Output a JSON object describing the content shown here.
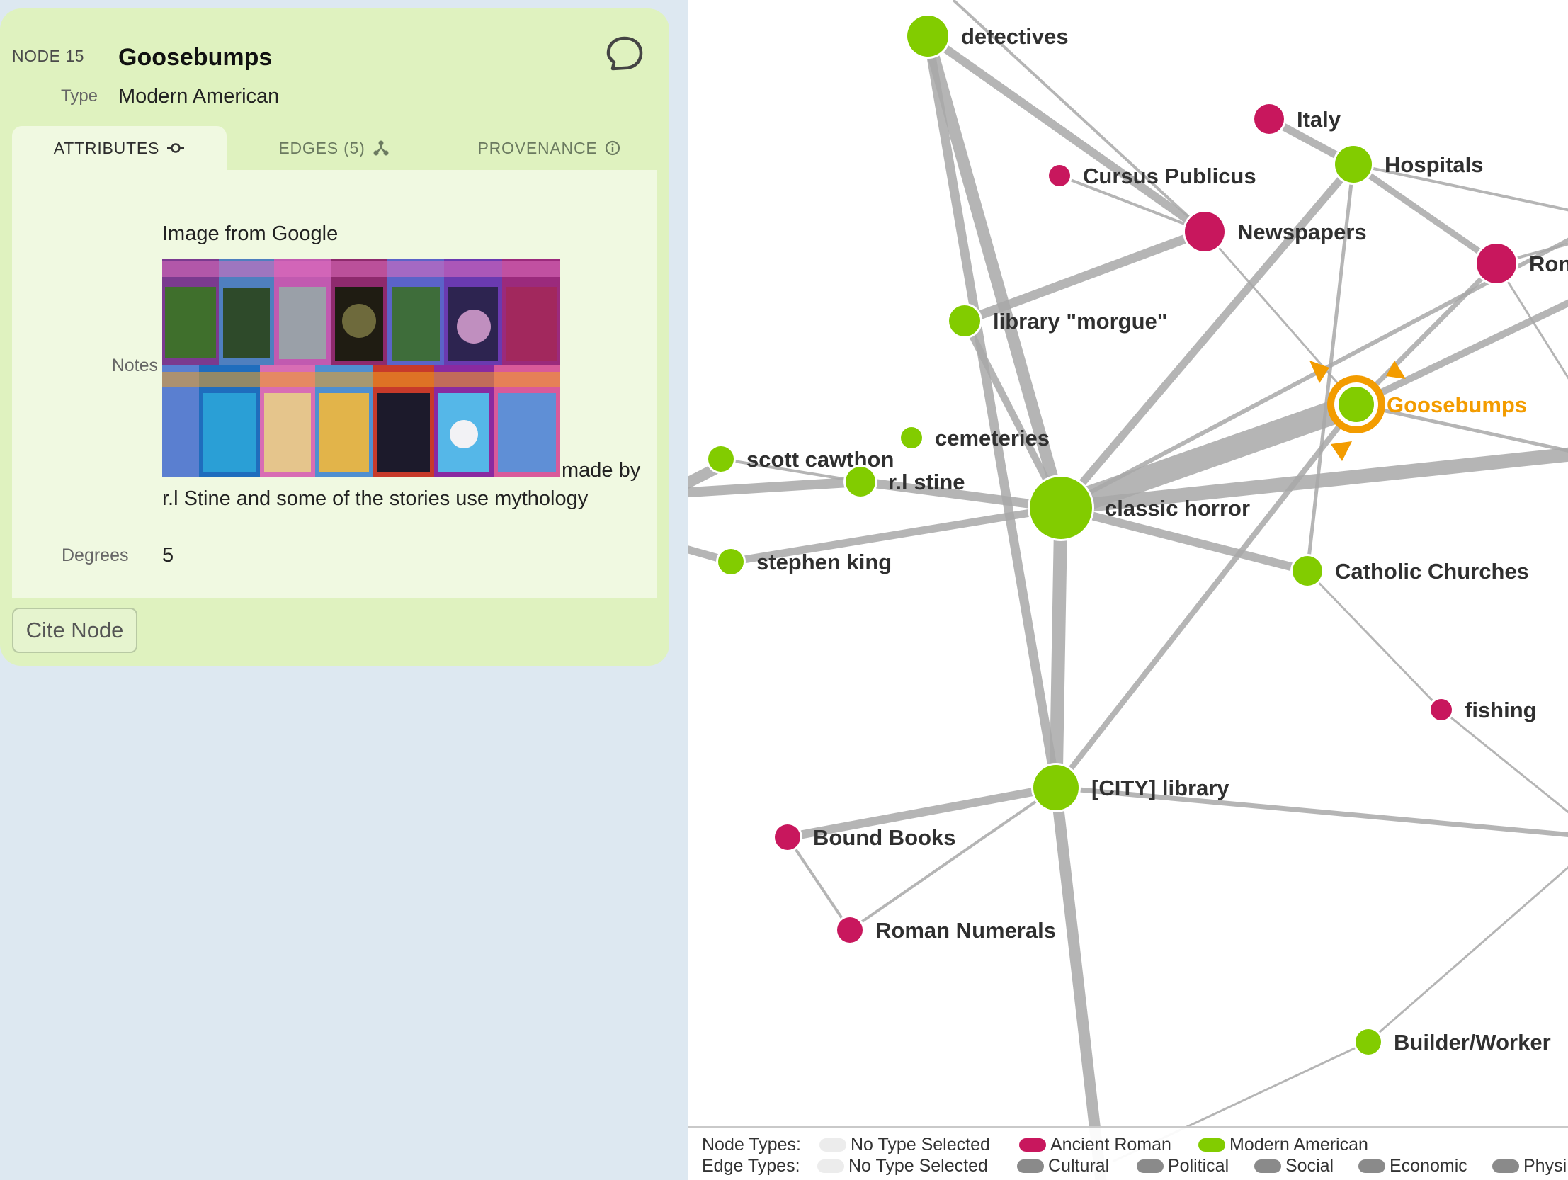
{
  "panel": {
    "node_id": "NODE 15",
    "title": "Goosebumps",
    "type_label": "Type",
    "type_value": "Modern American",
    "tabs": [
      {
        "label": "ATTRIBUTES",
        "icon": "node-icon"
      },
      {
        "label": "EDGES (5)",
        "icon": "network-icon"
      },
      {
        "label": "PROVENANCE",
        "icon": "info-icon"
      }
    ],
    "notes_label": "Notes",
    "notes_head": "Image from Google",
    "notes_tail_1": "made by",
    "notes_tail_2": "r.l Stine and some of the stories use mythology",
    "degrees_label": "Degrees",
    "degrees_value": "5",
    "cite_button": "Cite Node",
    "colors": {
      "panel_bg": "#dff2bf",
      "tab_body_bg": "#f0f9e1"
    }
  },
  "graph": {
    "colors": {
      "ancient_roman": "#c8175d",
      "modern_american": "#82cc00",
      "selected": "#f39c00",
      "edge": "#a8a8a8"
    },
    "nodes": [
      {
        "label": "detectives",
        "type": "modern_american"
      },
      {
        "label": "Italy",
        "type": "ancient_roman"
      },
      {
        "label": "Hospitals",
        "type": "modern_american"
      },
      {
        "label": "Cursus Publicus",
        "type": "ancient_roman"
      },
      {
        "label": "Newspapers",
        "type": "ancient_roman"
      },
      {
        "label": "Ron",
        "type": "ancient_roman"
      },
      {
        "label": "library \"morgue\"",
        "type": "modern_american"
      },
      {
        "label": "Goosebumps",
        "type": "modern_american",
        "selected": true
      },
      {
        "label": "cemeteries",
        "type": "modern_american"
      },
      {
        "label": "scott cawthon",
        "type": "modern_american"
      },
      {
        "label": "r.l stine",
        "type": "modern_american"
      },
      {
        "label": "classic horror",
        "type": "modern_american"
      },
      {
        "label": "stephen king",
        "type": "modern_american"
      },
      {
        "label": "Catholic Churches",
        "type": "modern_american"
      },
      {
        "label": "fishing",
        "type": "ancient_roman"
      },
      {
        "label": "[CITY] library",
        "type": "modern_american"
      },
      {
        "label": "Bound Books",
        "type": "ancient_roman"
      },
      {
        "label": "Roman Numerals",
        "type": "ancient_roman"
      },
      {
        "label": "Builder/Worker",
        "type": "modern_american"
      }
    ]
  },
  "legend": {
    "node_types_label": "Node Types:",
    "edge_types_label": "Edge Types:",
    "node_types": [
      {
        "label": "No Type Selected",
        "color": "#ececec"
      },
      {
        "label": "Ancient Roman",
        "color": "#c8175d"
      },
      {
        "label": "Modern American",
        "color": "#82cc00"
      }
    ],
    "edge_types": [
      {
        "label": "No Type Selected",
        "color": "#ececec"
      },
      {
        "label": "Cultural",
        "color": "#8a8a8a"
      },
      {
        "label": "Political",
        "color": "#8a8a8a"
      },
      {
        "label": "Social",
        "color": "#8a8a8a"
      },
      {
        "label": "Economic",
        "color": "#8a8a8a"
      },
      {
        "label": "Physi",
        "color": "#8a8a8a"
      }
    ]
  }
}
